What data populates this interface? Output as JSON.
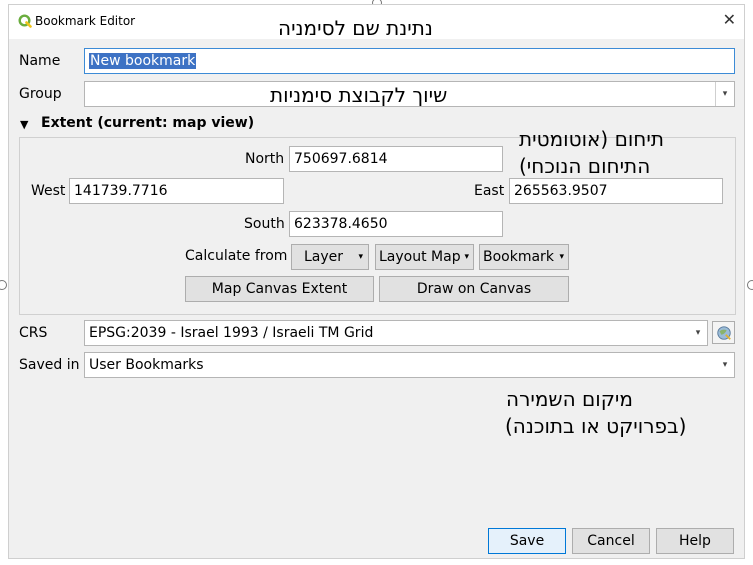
{
  "window": {
    "title": "Bookmark Editor",
    "close_glyph": "✕"
  },
  "form": {
    "name_label": "Name",
    "name_value": "New bookmark",
    "group_label": "Group",
    "group_value": "",
    "extent_header": "Extent (current: map view)",
    "extent_toggle_glyph": "▼",
    "north_label": "North",
    "north_value": "750697.6814",
    "west_label": "West",
    "west_value": "141739.7716",
    "east_label": "East",
    "east_value": "265563.9507",
    "south_label": "South",
    "south_value": "623378.4650",
    "calculate_label": "Calculate from",
    "calc_buttons": [
      "Layer",
      "Layout Map",
      "Bookmark"
    ],
    "map_canvas_extent": "Map Canvas Extent",
    "draw_on_canvas": "Draw on Canvas",
    "crs_label": "CRS",
    "crs_value": "EPSG:2039 - Israel 1993 / Israeli TM Grid",
    "saved_in_label": "Saved in",
    "saved_in_value": "User Bookmarks",
    "dropdown_glyph": "▾"
  },
  "buttons": {
    "save": "Save",
    "cancel": "Cancel",
    "help": "Help"
  },
  "annotations": {
    "name_note": "נתינת שם לסימניה",
    "group_note": "שיוך לקבוצת סימניות",
    "extent_note_line1": "תיחום (אוטומטית",
    "extent_note_line2": "התיחום הנוכחי)",
    "saved_note_line1": "מיקום השמירה",
    "saved_note_line2": "(בפרויקט או בתוכנה)"
  },
  "colors": {
    "selection": "#3d72c4",
    "focus_border": "#3c8bd6",
    "qgis_green": "#6aad3e"
  },
  "icons": {
    "app": "qgis-logo-icon",
    "crs": "crs-globe-icon"
  }
}
